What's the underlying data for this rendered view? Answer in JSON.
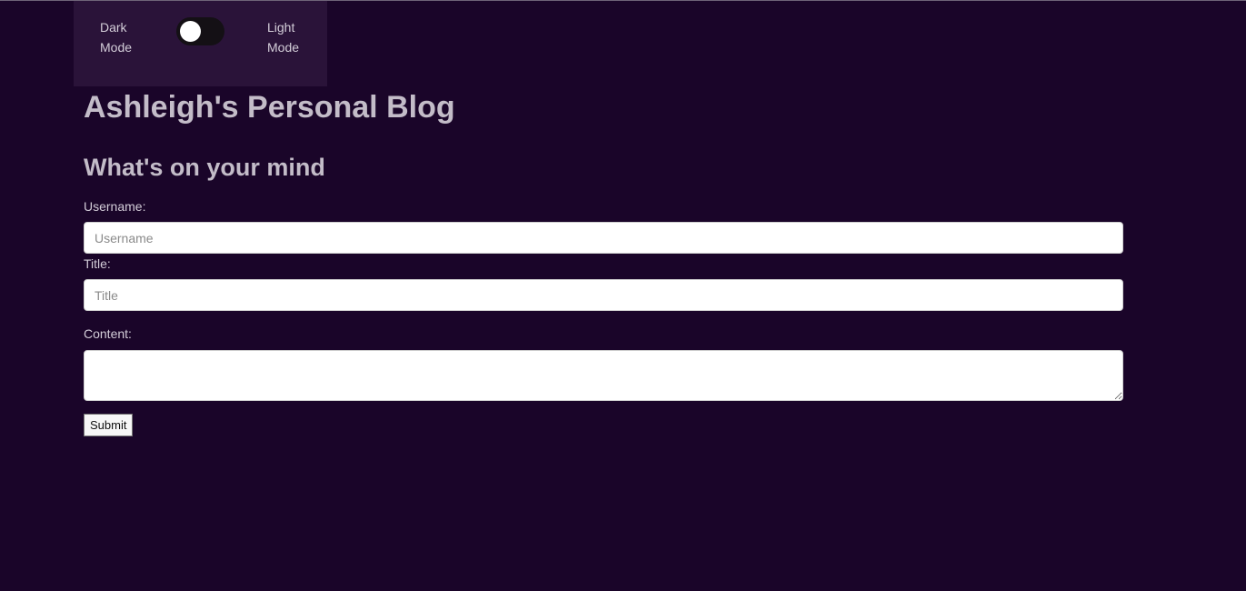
{
  "mode_toggle": {
    "dark_label": "Dark Mode",
    "light_label": "Light Mode"
  },
  "page": {
    "title": "Ashleigh's Personal Blog",
    "form_heading": "What's on your mind"
  },
  "form": {
    "username_label": "Username:",
    "username_placeholder": "Username",
    "username_value": "",
    "title_label": "Title:",
    "title_placeholder": "Title",
    "title_value": "",
    "content_label": "Content:",
    "content_value": "",
    "submit_label": "Submit"
  },
  "colors": {
    "background": "#1a0529",
    "panel": "#2a1339",
    "heading": "#c3bcc8"
  }
}
